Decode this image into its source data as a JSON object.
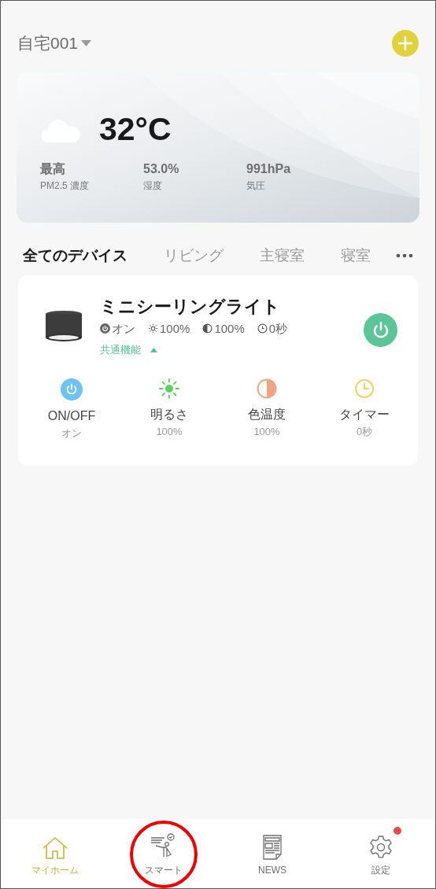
{
  "header": {
    "home_name": "自宅001"
  },
  "weather": {
    "temperature": "32°C",
    "stats": [
      {
        "value": "最高",
        "label": "PM2.5 濃度"
      },
      {
        "value": "53.0%",
        "label": "湿度"
      },
      {
        "value": "991hPa",
        "label": "気圧"
      }
    ]
  },
  "room_tabs": [
    {
      "label": "全てのデバイス",
      "selected": true
    },
    {
      "label": "リビング",
      "selected": false
    },
    {
      "label": "主寝室",
      "selected": false
    },
    {
      "label": "寝室",
      "selected": false
    }
  ],
  "device": {
    "name": "ミニシーリングライト",
    "on": true,
    "status": [
      {
        "kind": "power",
        "text": "オン"
      },
      {
        "kind": "brightness",
        "text": "100%"
      },
      {
        "kind": "color_temp",
        "text": "100%"
      },
      {
        "kind": "timer",
        "text": "0秒"
      }
    ],
    "functions_toggle": {
      "label": "共通機能",
      "expanded": true
    },
    "functions": [
      {
        "kind": "power",
        "label": "ON/OFF",
        "value": "オン"
      },
      {
        "kind": "brightness",
        "label": "明るさ",
        "value": "100%"
      },
      {
        "kind": "color_temp",
        "label": "色温度",
        "value": "100%"
      },
      {
        "kind": "timer",
        "label": "タイマー",
        "value": "0秒"
      }
    ]
  },
  "bottom_nav": [
    {
      "kind": "home",
      "label": "マイホーム",
      "selected": true,
      "badge": false,
      "circled": false
    },
    {
      "kind": "smart",
      "label": "スマート",
      "selected": false,
      "badge": false,
      "circled": true
    },
    {
      "kind": "news",
      "label": "NEWS",
      "selected": false,
      "badge": false,
      "circled": false
    },
    {
      "kind": "settings",
      "label": "設定",
      "selected": false,
      "badge": true,
      "circled": false
    }
  ]
}
